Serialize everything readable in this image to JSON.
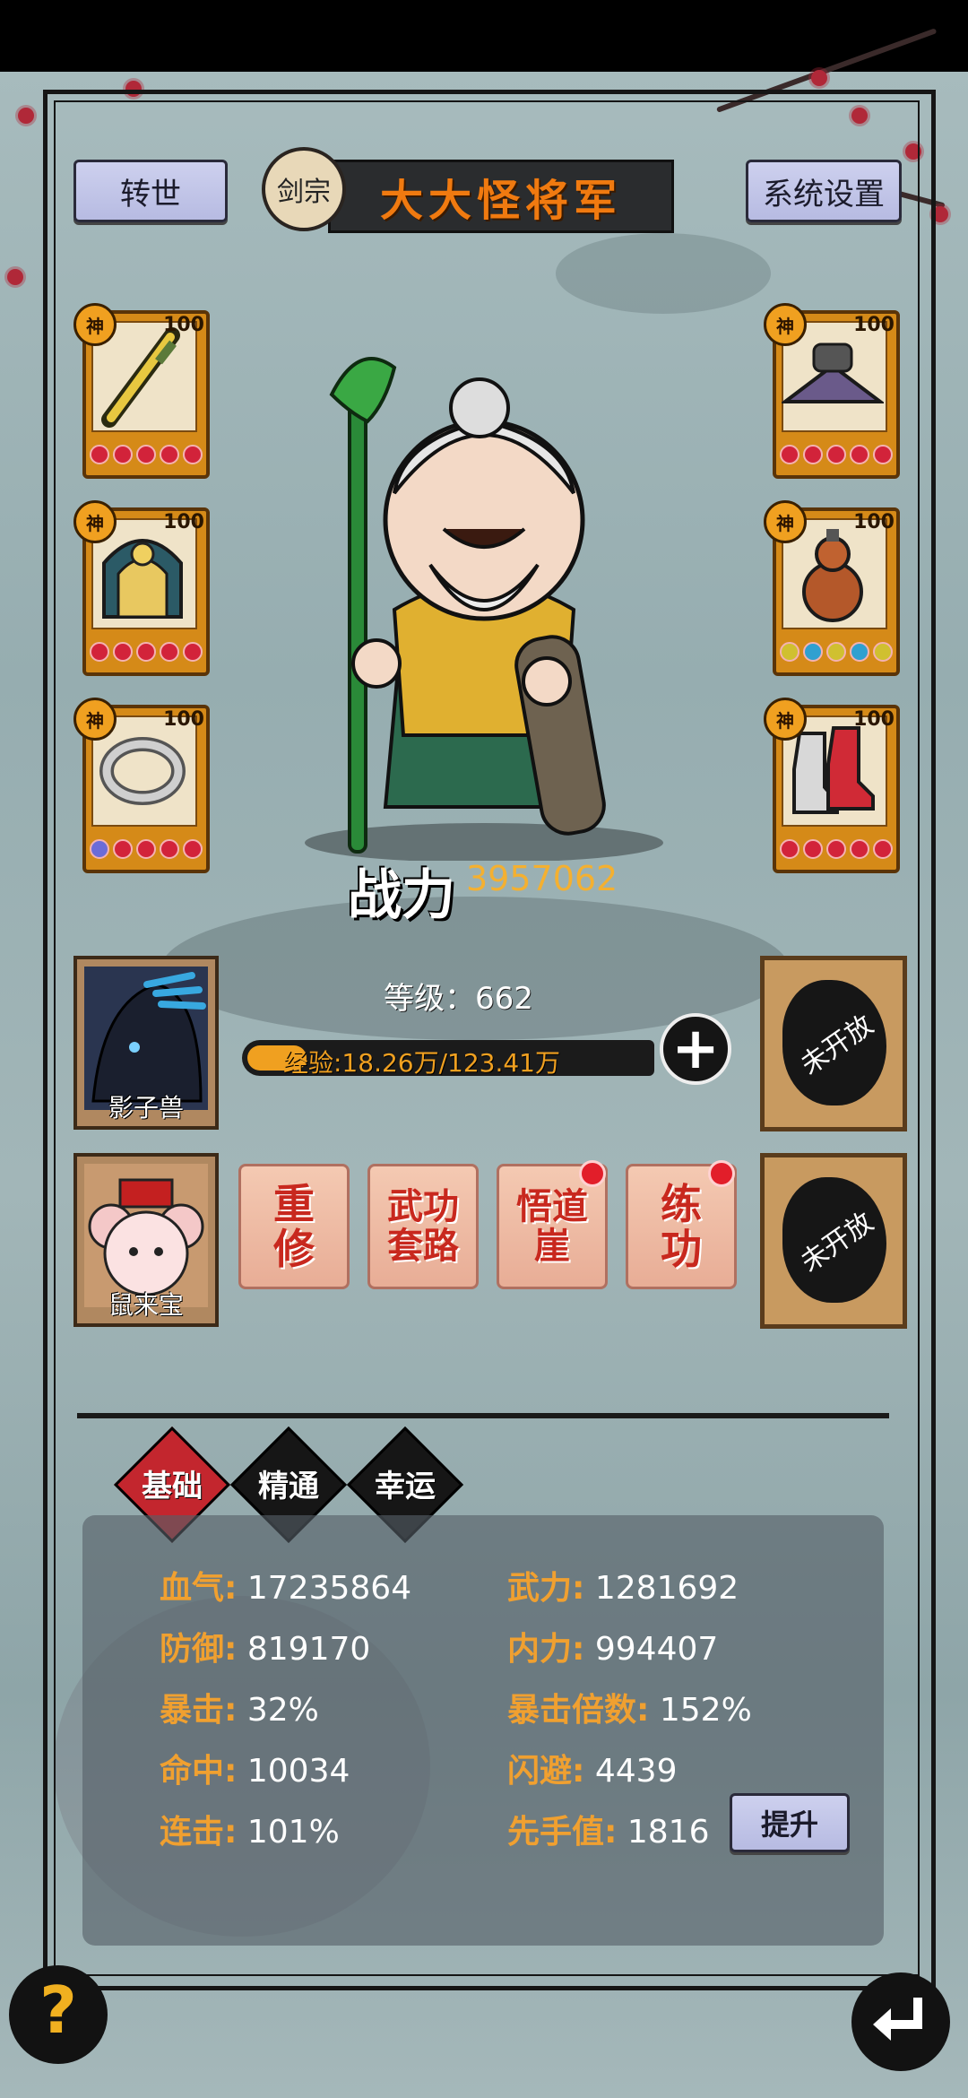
{
  "header": {
    "rebirth_label": "转世",
    "sect_label": "剑宗",
    "player_name": "大大怪将军",
    "settings_label": "系统设置"
  },
  "equipment": {
    "left": [
      {
        "badge": "神",
        "level": "100",
        "icon": "sword-icon",
        "gems": 5
      },
      {
        "badge": "神",
        "level": "100",
        "icon": "helmet-icon",
        "gems": 5
      },
      {
        "badge": "神",
        "level": "100",
        "icon": "ring-icon",
        "gems": 5
      }
    ],
    "right": [
      {
        "badge": "神",
        "level": "100",
        "icon": "hat-icon",
        "gems": 5
      },
      {
        "badge": "神",
        "level": "100",
        "icon": "gourd-icon",
        "gems": 5
      },
      {
        "badge": "神",
        "level": "100",
        "icon": "boots-icon",
        "gems": 5
      }
    ]
  },
  "character": {
    "power_label": "战力",
    "power_value": "3957062",
    "level_text": "等级：662",
    "exp_text": "经验:18.26万/123.41万",
    "exp_fraction": 0.148
  },
  "pets": [
    {
      "name": "影子兽",
      "icon": "shadow-beast-icon"
    },
    {
      "name": "鼠来宝",
      "icon": "mouse-pet-icon"
    }
  ],
  "locked_slots": [
    "未开放",
    "未开放"
  ],
  "actions": [
    {
      "label": "重修",
      "has_dot": false
    },
    {
      "label": "武功套路",
      "has_dot": false
    },
    {
      "label": "悟道崖",
      "has_dot": true
    },
    {
      "label": "练功",
      "has_dot": true
    }
  ],
  "tabs": [
    "基础",
    "精通",
    "幸运"
  ],
  "stats": {
    "hp": {
      "label": "血气:",
      "value": "17235864"
    },
    "force": {
      "label": "武力:",
      "value": "1281692"
    },
    "defense": {
      "label": "防御:",
      "value": "819170"
    },
    "inner": {
      "label": "内力:",
      "value": "994407"
    },
    "crit": {
      "label": "暴击:",
      "value": "32%"
    },
    "crit_mult": {
      "label": "暴击倍数:",
      "value": "152%"
    },
    "hit": {
      "label": "命中:",
      "value": "10034"
    },
    "dodge": {
      "label": "闪避:",
      "value": "4439"
    },
    "combo": {
      "label": "连击:",
      "value": "101%"
    },
    "initiative": {
      "label": "先手值:",
      "value": "1816"
    }
  },
  "upgrade_label": "提升",
  "help_icon": "?",
  "colors": {
    "accent": "#f07a10",
    "gem": "#d2233a",
    "stat_key": "#f0a030"
  }
}
